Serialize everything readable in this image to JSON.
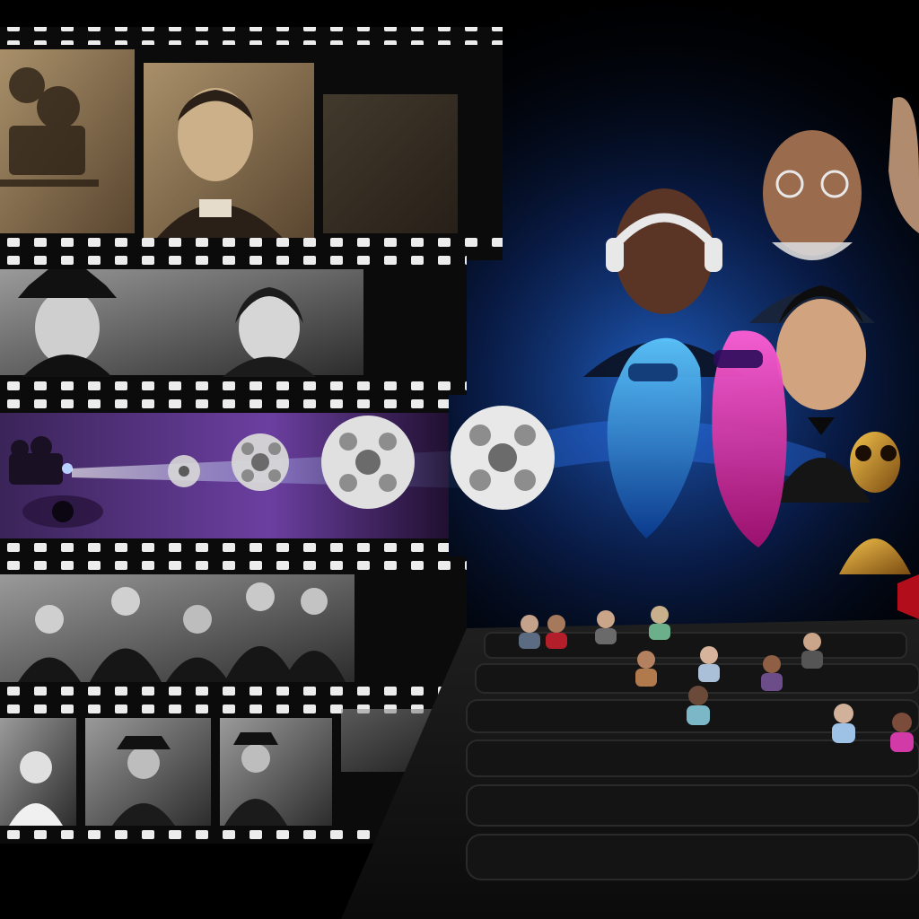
{
  "scene": {
    "type": "illustration",
    "theme_colors": {
      "background": "#000000",
      "sepia": "#8a6e4b",
      "film_strip": "#0b0b0b",
      "purple_glow": "#6a2da8",
      "blue_glow": "#1f6bff",
      "magenta_figure": "#ff2fb8",
      "cyan_figure": "#2aa8ff",
      "reel_silver": "#d7d7d7",
      "theater_floor": "#1b1b1b",
      "seat": "#141414"
    }
  },
  "film_strips": [
    {
      "panels": [
        "projector-sepia",
        "man-portrait-sepia",
        "faded-sepia"
      ]
    },
    {
      "panels": [
        "man-in-bowler-hat-bw",
        "woman-portrait-bw"
      ]
    },
    {
      "panels": [
        "projector-purple-light",
        "eye-closeup-purple"
      ]
    },
    {
      "panels": [
        "group-seated-bw"
      ]
    },
    {
      "panels": [
        "child-bw",
        "old-man-hat-bw",
        "seated-figure-bw",
        "landscape-bw"
      ]
    }
  ],
  "reels": [
    {
      "id": "reel-small-1"
    },
    {
      "id": "reel-small-2"
    },
    {
      "id": "reel-medium"
    },
    {
      "id": "reel-large"
    }
  ],
  "modern_characters": [
    {
      "name": "young-man-with-headphones"
    },
    {
      "name": "elderly-man-with-glasses"
    },
    {
      "name": "elderly-man-partial"
    },
    {
      "name": "young-man-in-suit"
    },
    {
      "name": "holographic-blue-figure"
    },
    {
      "name": "holographic-magenta-figure"
    },
    {
      "name": "alien-creature"
    }
  ],
  "theater": {
    "rows": 6,
    "audience": "mixed-age-audience"
  }
}
